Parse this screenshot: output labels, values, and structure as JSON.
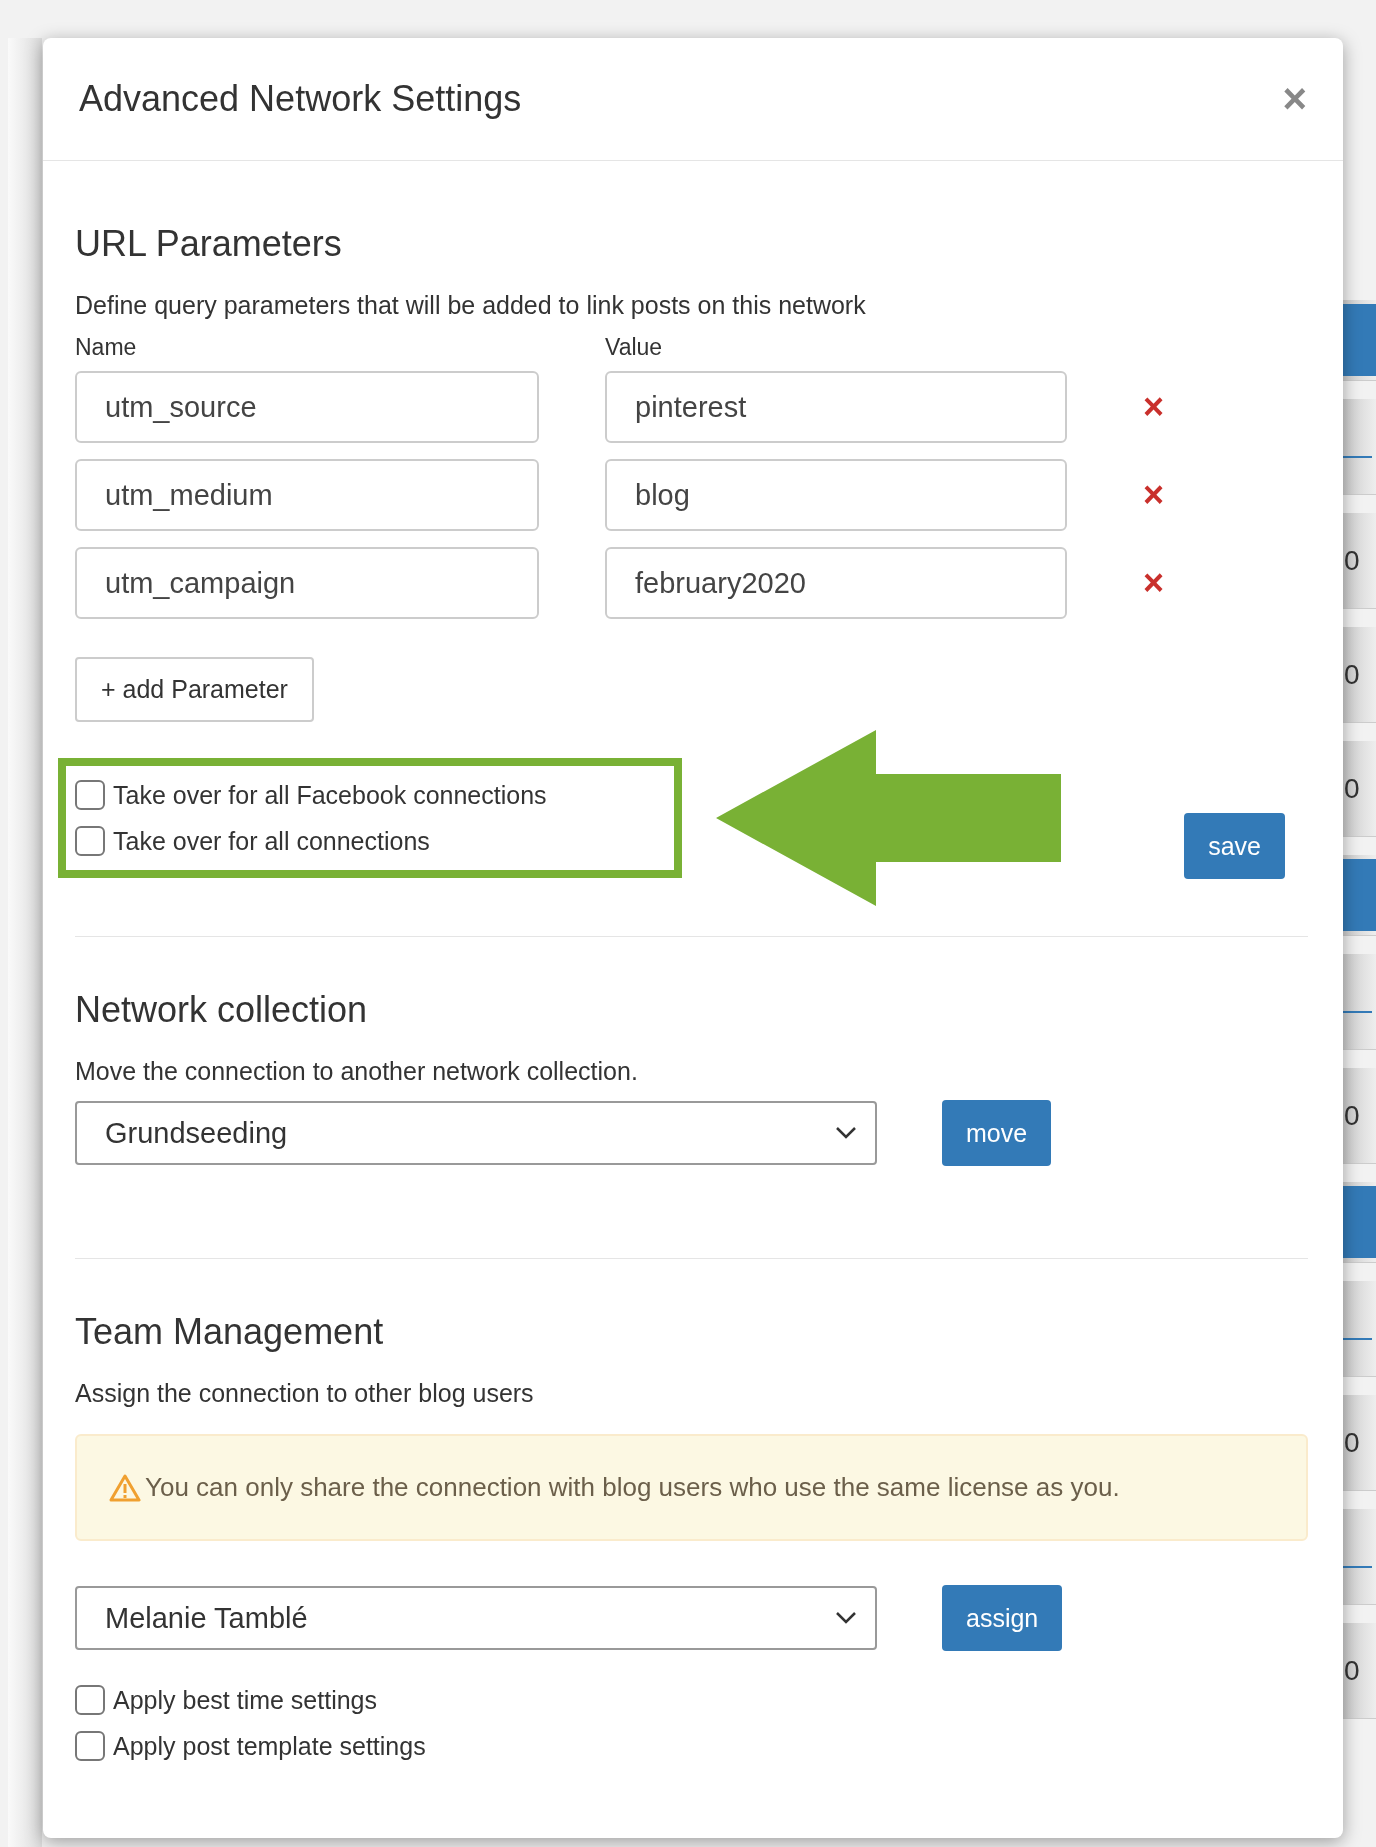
{
  "dialog": {
    "title": "Advanced Network Settings",
    "close": "×"
  },
  "url_parameters": {
    "heading": "URL Parameters",
    "description": "Define query parameters that will be added to link posts on this network",
    "name_label": "Name",
    "value_label": "Value",
    "rows": [
      {
        "name": "utm_source",
        "value": "pinterest",
        "remove": "×"
      },
      {
        "name": "utm_medium",
        "value": "blog",
        "remove": "×"
      },
      {
        "name": "utm_campaign",
        "value": "february2020",
        "remove": "×"
      }
    ],
    "add_button": "+ add Parameter",
    "options": [
      {
        "label": "Take over for all Facebook connections",
        "checked": false
      },
      {
        "label": "Take over for all connections",
        "checked": false
      }
    ],
    "highlighted": true,
    "save_button": "save"
  },
  "network_collection": {
    "heading": "Network collection",
    "description": "Move the connection to another network collection.",
    "selected": "Grundseeding",
    "button": "move"
  },
  "team_management": {
    "heading": "Team Management",
    "description": "Assign the connection to other blog users",
    "notice": "You can only share the connection with blog users who use the same license as you.",
    "selected": "Melanie Tamblé",
    "button": "assign",
    "options": [
      {
        "label": "Apply best time settings",
        "checked": false
      },
      {
        "label": "Apply post template settings",
        "checked": false
      }
    ]
  },
  "background": {
    "right_cells": [
      {
        "kind": "button"
      },
      {
        "kind": "link"
      },
      {
        "kind": "value",
        "text": "0"
      },
      {
        "kind": "value",
        "text": "0"
      },
      {
        "kind": "value",
        "text": "0"
      },
      {
        "kind": "button"
      },
      {
        "kind": "link"
      },
      {
        "kind": "value",
        "text": "0"
      },
      {
        "kind": "button"
      },
      {
        "kind": "link"
      },
      {
        "kind": "value",
        "text": "0"
      },
      {
        "kind": "link"
      },
      {
        "kind": "value",
        "text": "0"
      }
    ]
  }
}
